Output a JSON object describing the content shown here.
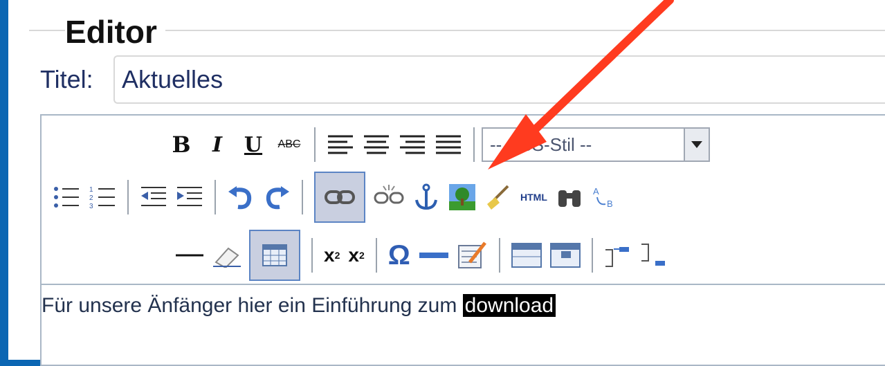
{
  "header": {
    "editor_label": "Editor"
  },
  "title_field": {
    "label": "Titel:",
    "value": "Aktuelles"
  },
  "toolbar": {
    "bold": "B",
    "italic": "I",
    "underline": "U",
    "strikethrough": "ABC",
    "css_select_value": "-- CSS-Stil --",
    "html_label": "HTML",
    "subscript": "x",
    "superscript": "x"
  },
  "content": {
    "text_before": "Für unsere Änfänger hier ein Einführung zum ",
    "highlighted": "download"
  },
  "colors": {
    "background": "#0b66b3",
    "arrow": "#ff3b1f",
    "selection": "#000000"
  }
}
